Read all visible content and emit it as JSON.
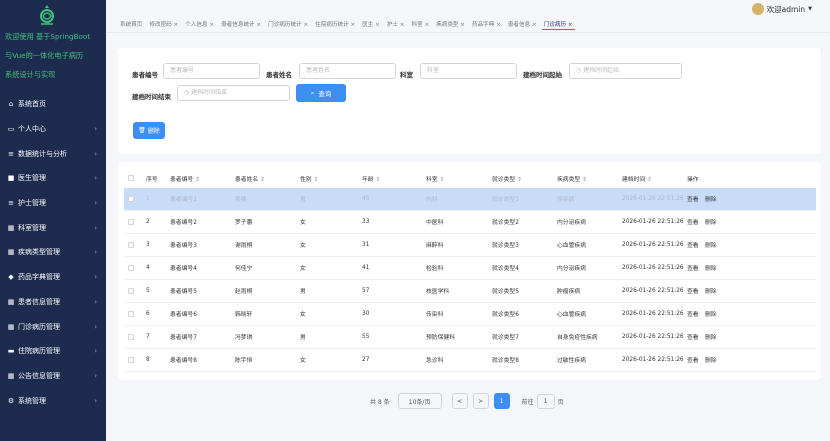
{
  "sidebar": {
    "title": "欢迎使用 基于SpringBoot与Vue的一体化电子病历系统设计与实现",
    "title_lines": [
      "欢迎使用 基于SpringBoot",
      "与Vue的一体化电子病历",
      "系统设计与实现"
    ],
    "items": [
      {
        "label": "系统首页",
        "icon": "home-icon",
        "has_children": false
      },
      {
        "label": "个人中心",
        "icon": "person-card-icon",
        "has_children": true
      },
      {
        "label": "数据统计与分析",
        "icon": "stats-icon",
        "has_children": true
      },
      {
        "label": "医生管理",
        "icon": "doctor-icon",
        "has_children": true
      },
      {
        "label": "护士管理",
        "icon": "nurse-icon",
        "has_children": true
      },
      {
        "label": "科室管理",
        "icon": "grid-icon",
        "has_children": true
      },
      {
        "label": "疾病类型管理",
        "icon": "grid-icon",
        "has_children": true
      },
      {
        "label": "药品字典管理",
        "icon": "pill-icon",
        "has_children": true
      },
      {
        "label": "患者信息管理",
        "icon": "grid-icon",
        "has_children": true
      },
      {
        "label": "门诊病历管理",
        "icon": "grid-icon",
        "has_children": true
      },
      {
        "label": "住院病历管理",
        "icon": "bed-icon",
        "has_children": true
      },
      {
        "label": "公告信息管理",
        "icon": "grid-icon",
        "has_children": true
      },
      {
        "label": "系统管理",
        "icon": "gear-icon",
        "has_children": true
      }
    ]
  },
  "header": {
    "user_label": "欢迎admin",
    "dropdown_glyph": "▼"
  },
  "tabs": [
    {
      "label": "系统首页",
      "active": false
    },
    {
      "label": "修改密码 ×",
      "active": false
    },
    {
      "label": "个人信息 ×",
      "active": false
    },
    {
      "label": "患者信息统计 ×",
      "active": false
    },
    {
      "label": "门诊病历统计 ×",
      "active": false
    },
    {
      "label": "住院病历统计 ×",
      "active": false
    },
    {
      "label": "医生 ×",
      "active": false
    },
    {
      "label": "护士 ×",
      "active": false
    },
    {
      "label": "科室 ×",
      "active": false
    },
    {
      "label": "疾病类型 ×",
      "active": false
    },
    {
      "label": "药品字典 ×",
      "active": false
    },
    {
      "label": "患者信息 ×",
      "active": false
    },
    {
      "label": "门诊病历 ×",
      "active": true
    }
  ],
  "search": {
    "patient_no_label": "患者编号",
    "patient_no_placeholder": "患者编号",
    "patient_name_label": "患者姓名",
    "patient_name_placeholder": "患者姓名",
    "dept_label": "科室",
    "dept_placeholder": "科室",
    "start_label": "建档时间起始",
    "start_placeholder": "建档时间起始",
    "end_label": "建档时间结束",
    "end_placeholder": "建档时间结束",
    "query_button": "查询",
    "delete_button": "删除"
  },
  "table": {
    "columns": [
      "序号",
      "患者编号",
      "患者姓名",
      "性别",
      "年龄",
      "科室",
      "就诊类型",
      "疾病类型",
      "建档时间",
      "操作"
    ],
    "sortable": [
      false,
      true,
      true,
      true,
      true,
      true,
      true,
      true,
      true,
      false
    ],
    "view_label": "查看",
    "delete_label": "删除",
    "rows": [
      {
        "no": "1",
        "pid": "患者编号1",
        "name": "吴强",
        "gender": "男",
        "age": "45",
        "dept": "内科",
        "visit": "就诊类型1",
        "disease": "传染病",
        "time": "2026-01-26 22:51:26",
        "selected": true
      },
      {
        "no": "2",
        "pid": "患者编号2",
        "name": "罗子蕙",
        "gender": "女",
        "age": "33",
        "dept": "中医科",
        "visit": "就诊类型2",
        "disease": "内分泌疾病",
        "time": "2026-01-26 22:51:26",
        "selected": false
      },
      {
        "no": "3",
        "pid": "患者编号3",
        "name": "谢雨桐",
        "gender": "女",
        "age": "31",
        "dept": "麻醉科",
        "visit": "就诊类型3",
        "disease": "心血管疾病",
        "time": "2026-01-26 22:51:26",
        "selected": false
      },
      {
        "no": "4",
        "pid": "患者编号4",
        "name": "何佳宁",
        "gender": "女",
        "age": "41",
        "dept": "检验科",
        "visit": "就诊类型4",
        "disease": "内分泌疾病",
        "time": "2026-01-26 22:51:26",
        "selected": false
      },
      {
        "no": "5",
        "pid": "患者编号5",
        "name": "赵雨桐",
        "gender": "男",
        "age": "57",
        "dept": "核医学科",
        "visit": "就诊类型5",
        "disease": "肿瘤疾病",
        "time": "2026-01-26 22:51:26",
        "selected": false
      },
      {
        "no": "6",
        "pid": "患者编号6",
        "name": "韩晓轩",
        "gender": "女",
        "age": "30",
        "dept": "传染科",
        "visit": "就诊类型6",
        "disease": "心血管疾病",
        "time": "2026-01-26 22:51:26",
        "selected": false
      },
      {
        "no": "7",
        "pid": "患者编号7",
        "name": "冯梦琪",
        "gender": "男",
        "age": "55",
        "dept": "预防保健科",
        "visit": "就诊类型7",
        "disease": "自身免疫性疾病",
        "time": "2026-01-26 22:51:26",
        "selected": false
      },
      {
        "no": "8",
        "pid": "患者编号8",
        "name": "陈宇恒",
        "gender": "女",
        "age": "27",
        "dept": "急诊科",
        "visit": "就诊类型8",
        "disease": "过敏性疾病",
        "time": "2026-01-26 22:51:26",
        "selected": false
      }
    ]
  },
  "pagination": {
    "total": "共 8 条",
    "page_size": "10条/页",
    "prev": "<",
    "next": ">",
    "current_page": "1",
    "goto_label": "前往",
    "goto_value": "1",
    "goto_suffix": "页"
  },
  "colors": {
    "sidebar_bg": "#1d2b4f",
    "title_green": "#3ec27a",
    "accent_blue": "#3d8ef0",
    "selected_row": "#c9dcf7"
  }
}
